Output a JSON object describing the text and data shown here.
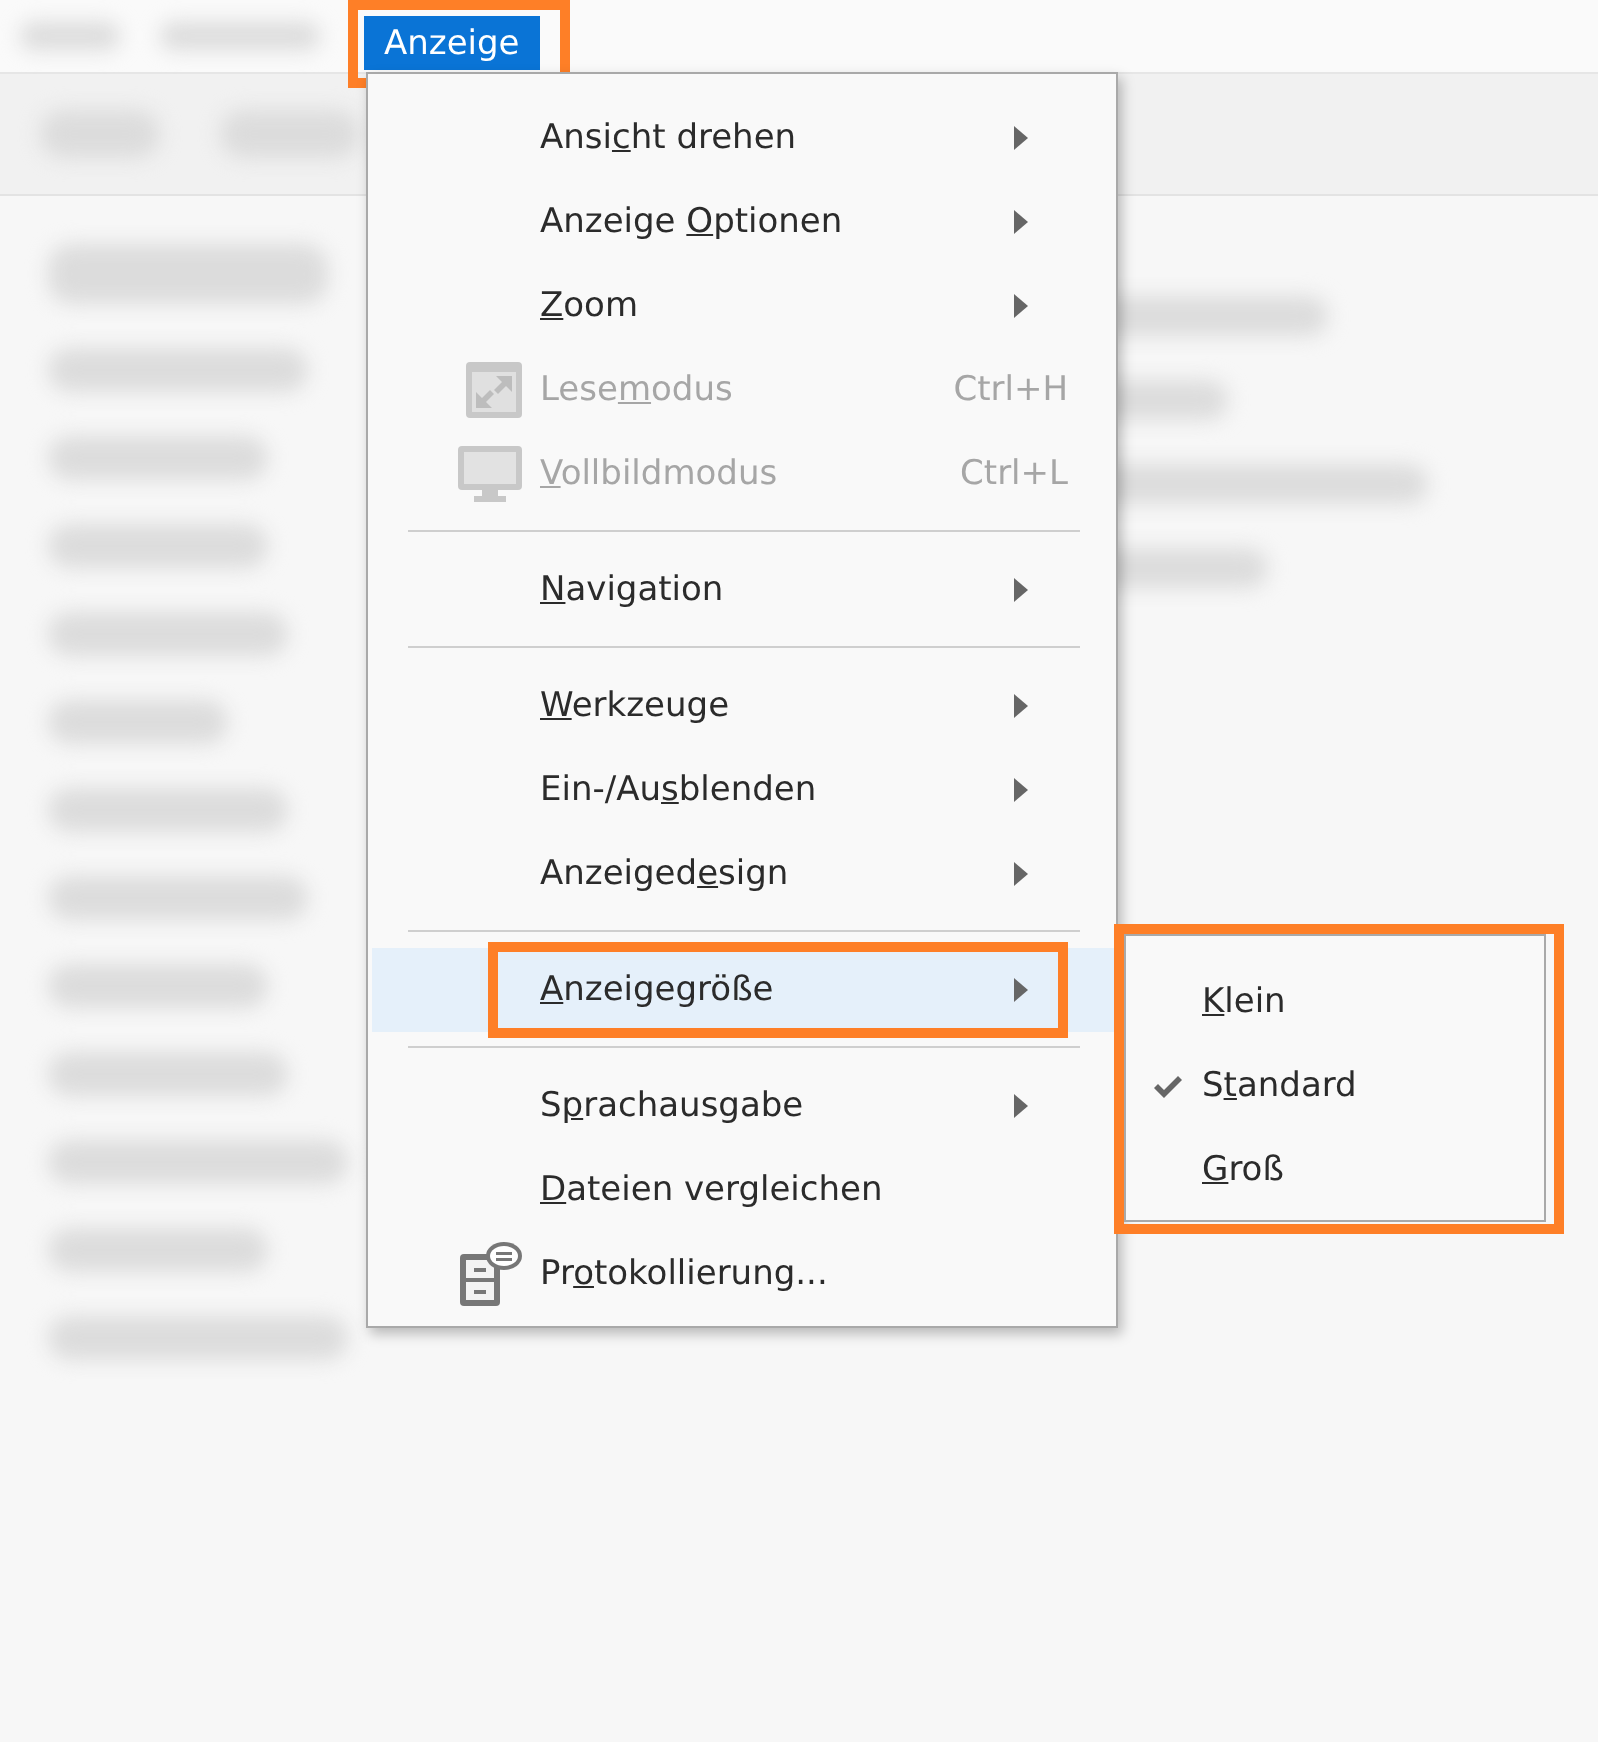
{
  "menu_bar": {
    "open_menu": {
      "label": "Anzeige",
      "selected": true,
      "emphasized": true
    }
  },
  "menu": {
    "items": [
      {
        "kind": "submenu",
        "label": {
          "before": "Ansi",
          "key": "c",
          "after": "ht drehen"
        },
        "disabled": false,
        "selected": false,
        "emphasized": false
      },
      {
        "kind": "submenu",
        "label": {
          "before": "Anzeige ",
          "key": "O",
          "after": "ptionen"
        },
        "disabled": false,
        "selected": false,
        "emphasized": false
      },
      {
        "kind": "submenu",
        "label": {
          "key": "Z",
          "after": "oom"
        },
        "disabled": false,
        "selected": false,
        "emphasized": false
      },
      {
        "kind": "command",
        "label": {
          "before": "Lese",
          "key": "m",
          "after": "odus"
        },
        "shortcut": "Ctrl+H",
        "disabled": true,
        "selected": false,
        "emphasized": false
      },
      {
        "kind": "command",
        "label": {
          "key": "V",
          "after": "ollbildmodus"
        },
        "shortcut": "Ctrl+L",
        "disabled": true,
        "selected": false,
        "emphasized": false
      },
      {
        "kind": "separator"
      },
      {
        "kind": "submenu",
        "label": {
          "key": "N",
          "after": "avigation"
        },
        "disabled": false,
        "selected": false,
        "emphasized": false
      },
      {
        "kind": "separator"
      },
      {
        "kind": "submenu",
        "label": {
          "key": "W",
          "after": "erkzeuge"
        },
        "disabled": false,
        "selected": false,
        "emphasized": false
      },
      {
        "kind": "submenu",
        "label": {
          "before": "Ein-/Au",
          "key": "s",
          "after": "blenden"
        },
        "disabled": false,
        "selected": false,
        "emphasized": false
      },
      {
        "kind": "submenu",
        "label": {
          "before": "Anzeiged",
          "key": "e",
          "after": "sign"
        },
        "disabled": false,
        "selected": false,
        "emphasized": false
      },
      {
        "kind": "separator"
      },
      {
        "kind": "submenu",
        "label": {
          "key": "A",
          "after": "nzeigegröße"
        },
        "disabled": false,
        "selected": true,
        "emphasized": true
      },
      {
        "kind": "separator"
      },
      {
        "kind": "submenu",
        "label": {
          "before": "S",
          "key": "p",
          "after": "rachausgabe"
        },
        "disabled": false,
        "selected": false,
        "emphasized": false
      },
      {
        "kind": "command",
        "label": {
          "key": "D",
          "after": "ateien vergleichen"
        },
        "disabled": false,
        "selected": false,
        "emphasized": false
      },
      {
        "kind": "command",
        "label": {
          "before": "Pr",
          "key": "o",
          "after": "tokollierung..."
        },
        "disabled": false,
        "selected": false,
        "emphasized": false
      }
    ]
  },
  "submenu": {
    "emphasized": true,
    "items": [
      {
        "label": {
          "key": "K",
          "after": "lein"
        },
        "checked": false
      },
      {
        "label": {
          "before": "S",
          "key": "t",
          "after": "andard"
        },
        "checked": true
      },
      {
        "label": {
          "key": "G",
          "after": "roß"
        },
        "checked": false
      }
    ]
  }
}
